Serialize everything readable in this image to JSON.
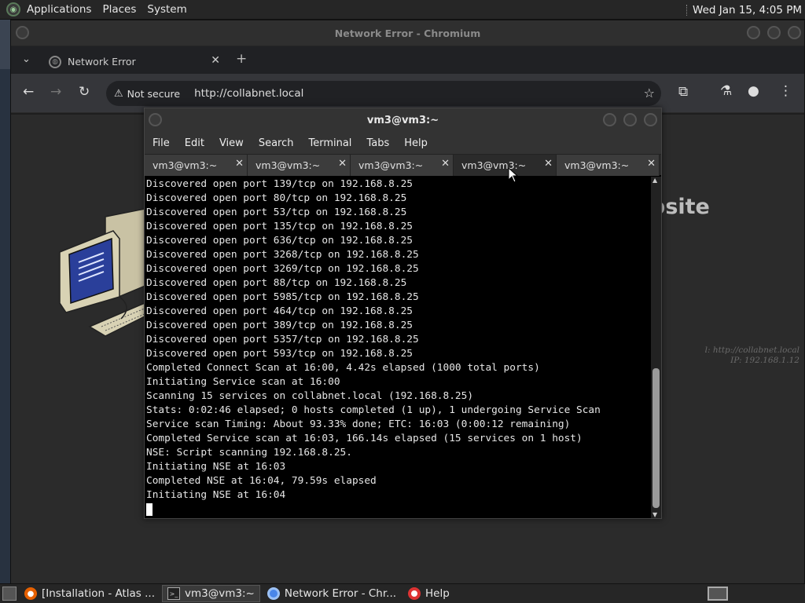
{
  "top_panel": {
    "menus": [
      "Applications",
      "Places",
      "System"
    ],
    "clock": "Wed Jan 15,  4:05 PM"
  },
  "chromium": {
    "window_title": "Network Error - Chromium",
    "tab_title": "Network Error",
    "not_secure_label": "Not secure",
    "url": "http://collabnet.local",
    "page": {
      "heading_partial": "bsite",
      "host_line1": "l: http://collabnet.local",
      "host_line2": "IP: 192.168.1.12"
    }
  },
  "terminal": {
    "window_title": "vm3@vm3:~",
    "menu": [
      "File",
      "Edit",
      "View",
      "Search",
      "Terminal",
      "Tabs",
      "Help"
    ],
    "tabs": [
      {
        "label": "vm3@vm3:~",
        "active": false
      },
      {
        "label": "vm3@vm3:~",
        "active": false
      },
      {
        "label": "vm3@vm3:~",
        "active": false
      },
      {
        "label": "vm3@vm3:~",
        "active": true
      },
      {
        "label": "vm3@vm3:~",
        "active": false
      }
    ],
    "lines": [
      "Discovered open port 139/tcp on 192.168.8.25",
      "Discovered open port 80/tcp on 192.168.8.25",
      "Discovered open port 53/tcp on 192.168.8.25",
      "Discovered open port 135/tcp on 192.168.8.25",
      "Discovered open port 636/tcp on 192.168.8.25",
      "Discovered open port 3268/tcp on 192.168.8.25",
      "Discovered open port 3269/tcp on 192.168.8.25",
      "Discovered open port 88/tcp on 192.168.8.25",
      "Discovered open port 5985/tcp on 192.168.8.25",
      "Discovered open port 464/tcp on 192.168.8.25",
      "Discovered open port 389/tcp on 192.168.8.25",
      "Discovered open port 5357/tcp on 192.168.8.25",
      "Discovered open port 593/tcp on 192.168.8.25",
      "Completed Connect Scan at 16:00, 4.42s elapsed (1000 total ports)",
      "Initiating Service scan at 16:00",
      "Scanning 15 services on collabnet.local (192.168.8.25)",
      "Stats: 0:02:46 elapsed; 0 hosts completed (1 up), 1 undergoing Service Scan",
      "Service scan Timing: About 93.33% done; ETC: 16:03 (0:00:12 remaining)",
      "Completed Service scan at 16:03, 166.14s elapsed (15 services on 1 host)",
      "NSE: Script scanning 192.168.8.25.",
      "Initiating NSE at 16:03",
      "Completed NSE at 16:04, 79.59s elapsed",
      "Initiating NSE at 16:04"
    ]
  },
  "taskbar": {
    "tasks": [
      {
        "label": "[Installation - Atlas ...",
        "icon": "firefox-icon",
        "active": false
      },
      {
        "label": "vm3@vm3:~",
        "icon": "terminal-icon",
        "active": true
      },
      {
        "label": "Network Error - Chr...",
        "icon": "chromium-icon",
        "active": false
      },
      {
        "label": "Help",
        "icon": "help-lifebuoy-icon",
        "active": false
      }
    ]
  },
  "colors": {
    "desktop": "#3b4452",
    "panel": "#262626",
    "terminal_bg": "#000000",
    "terminal_fg": "#e6e6e6"
  }
}
